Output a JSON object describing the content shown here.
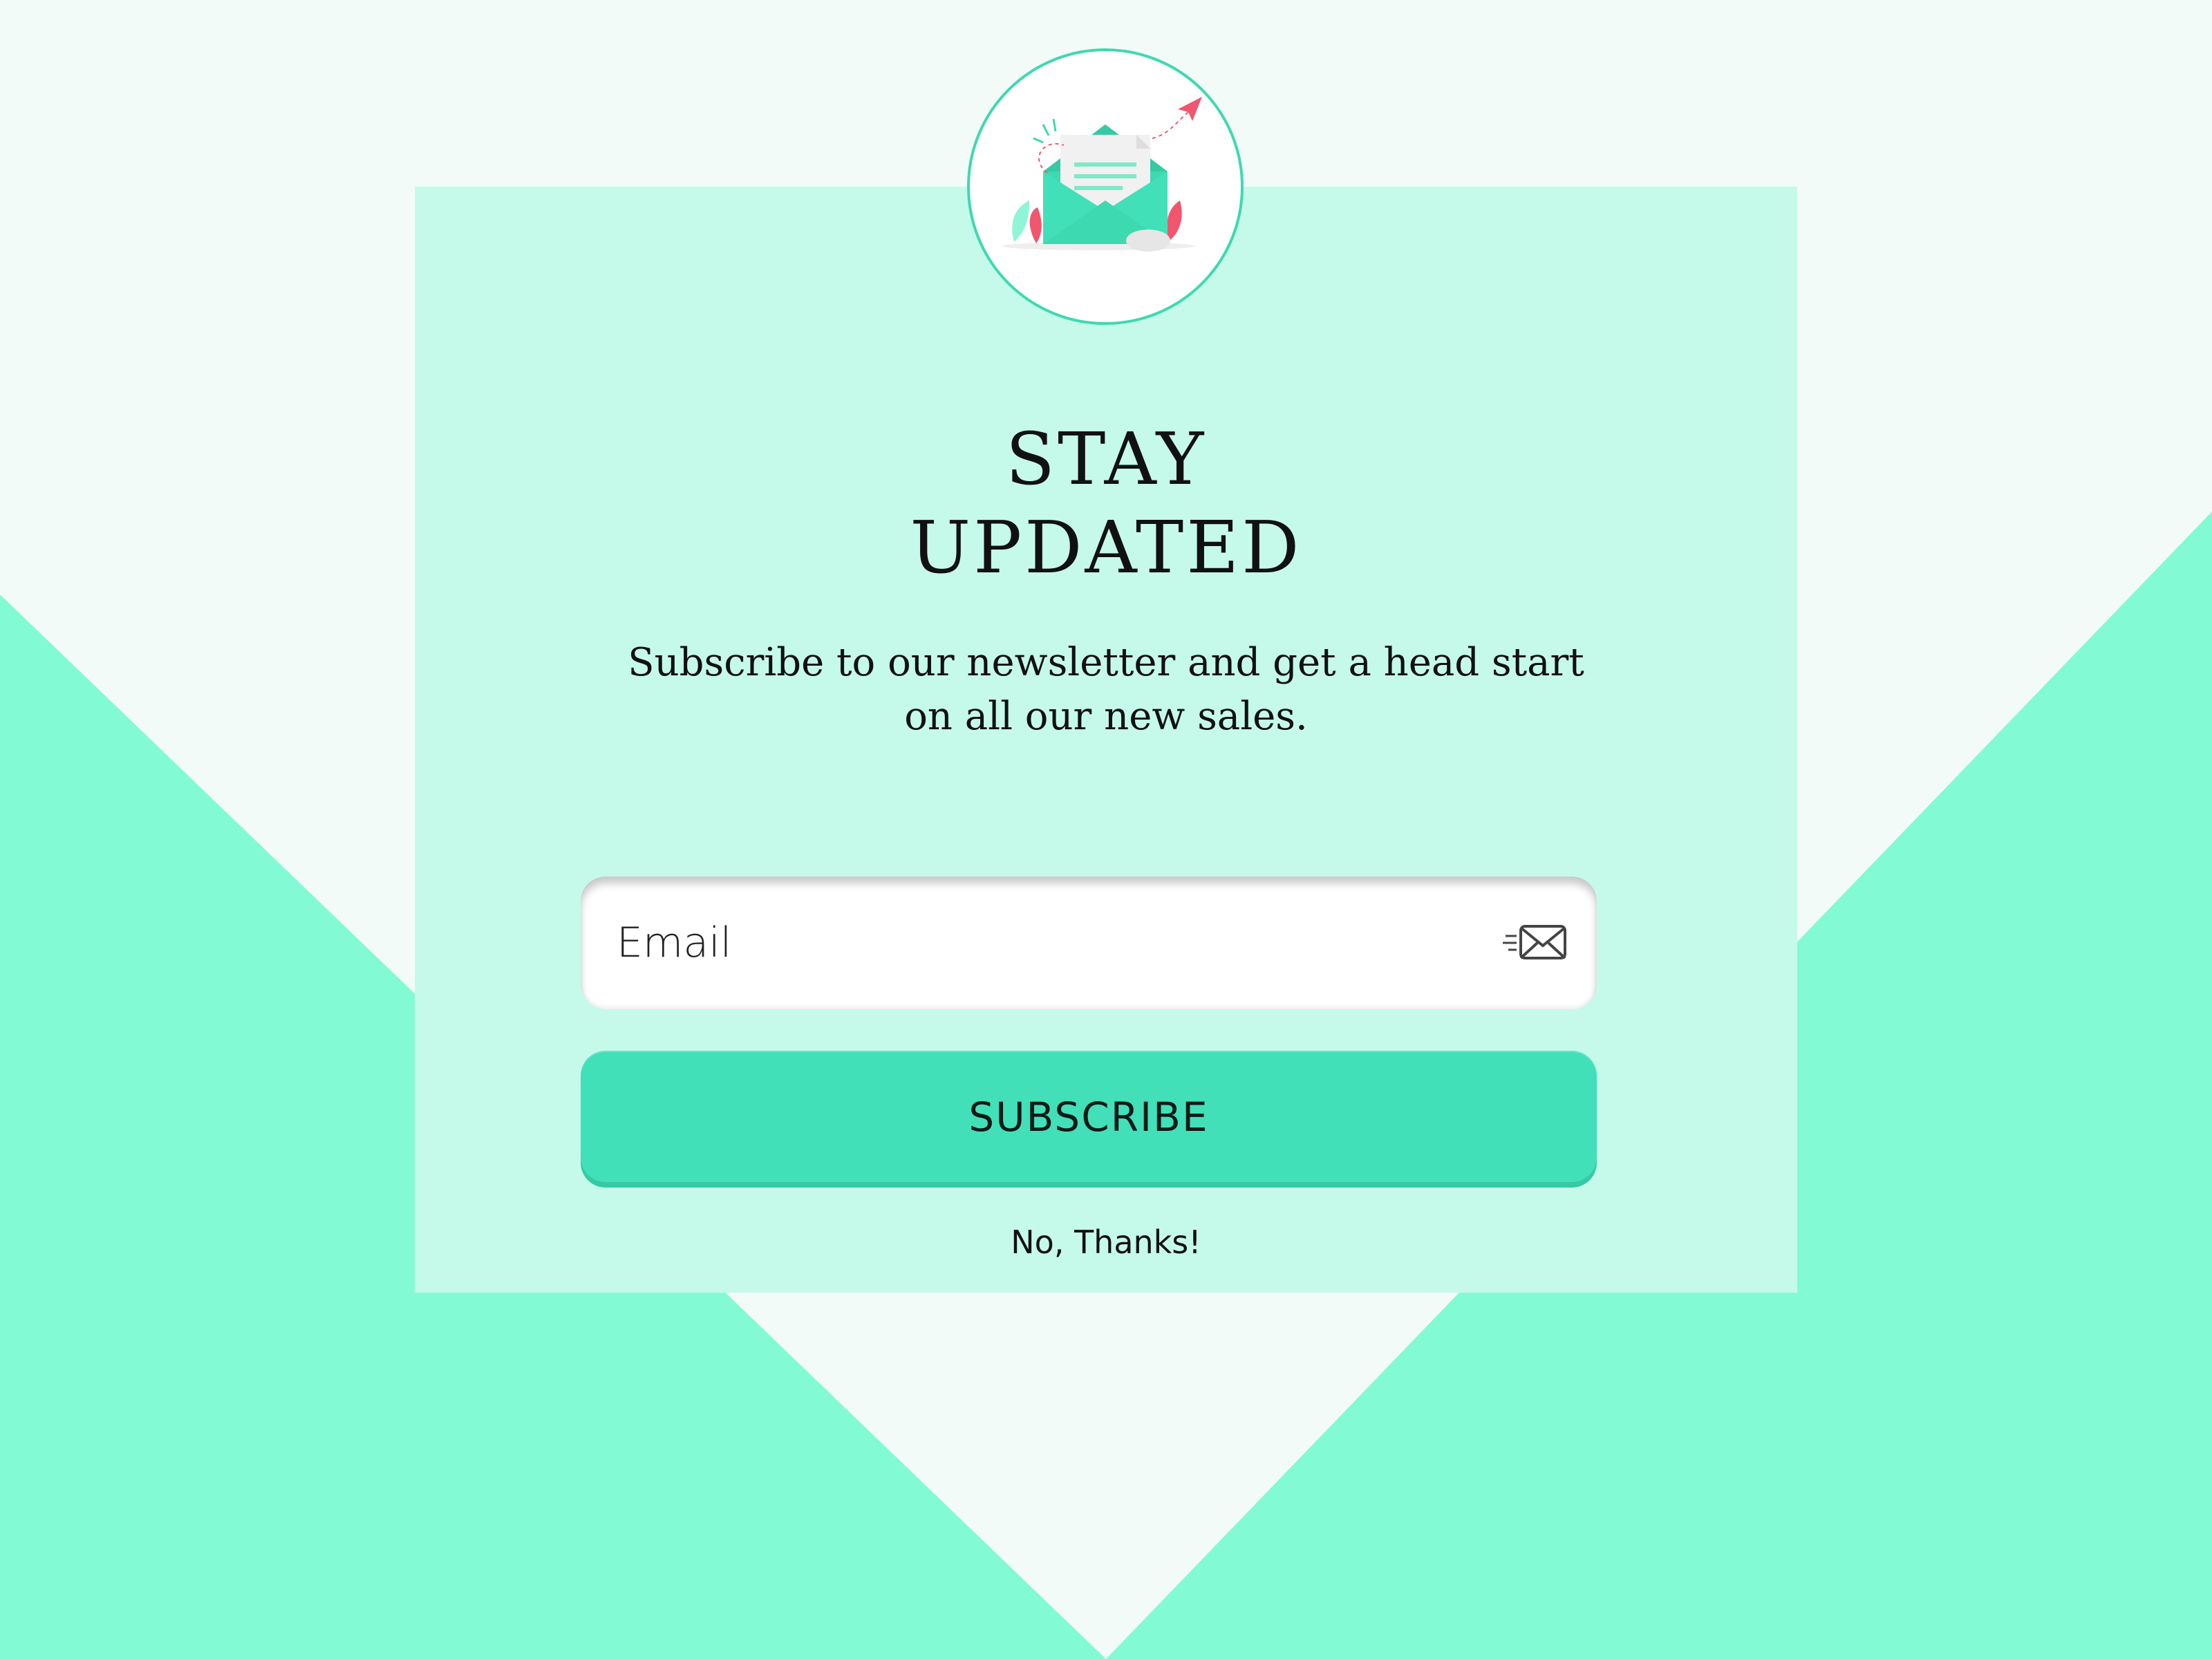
{
  "colors": {
    "page_background": "#f3fbf8",
    "card_background": "#c5faea",
    "background_triangles": "#82fbd4",
    "accent": "#42e0b8",
    "illustration_red": "#f0566e"
  },
  "header": {
    "logo_icon": "open-envelope-illustration"
  },
  "title": {
    "line1": "STAY",
    "line2": "UPDATED"
  },
  "subtitle": "Subscribe to our newsletter and get a head start on all our new sales.",
  "form": {
    "email_placeholder": "Email",
    "email_value": "",
    "email_icon": "send-mail-icon",
    "subscribe_label": "SUBSCRIBE",
    "dismiss_label": "No, Thanks!"
  }
}
